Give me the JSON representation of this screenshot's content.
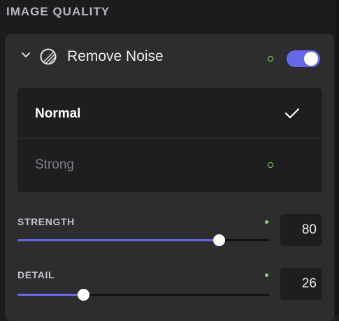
{
  "section": {
    "title": "IMAGE QUALITY"
  },
  "feature": {
    "title": "Remove Noise",
    "enabled": true,
    "expanded": true,
    "options": [
      {
        "label": "Normal",
        "selected": true
      },
      {
        "label": "Strong",
        "selected": false
      }
    ]
  },
  "sliders": [
    {
      "label": "STRENGTH",
      "value": "80",
      "min": 0,
      "max": 100
    },
    {
      "label": "DETAIL",
      "value": "26",
      "min": 0,
      "max": 100
    }
  ],
  "colors": {
    "accent": "#6767ea",
    "indicator": "#8bd36e",
    "panel": "#2d2d30",
    "background": "#1c1c1f"
  },
  "icons": {
    "collapse": "chevron-down-icon",
    "feature": "noise-icon",
    "selected": "check-icon"
  }
}
